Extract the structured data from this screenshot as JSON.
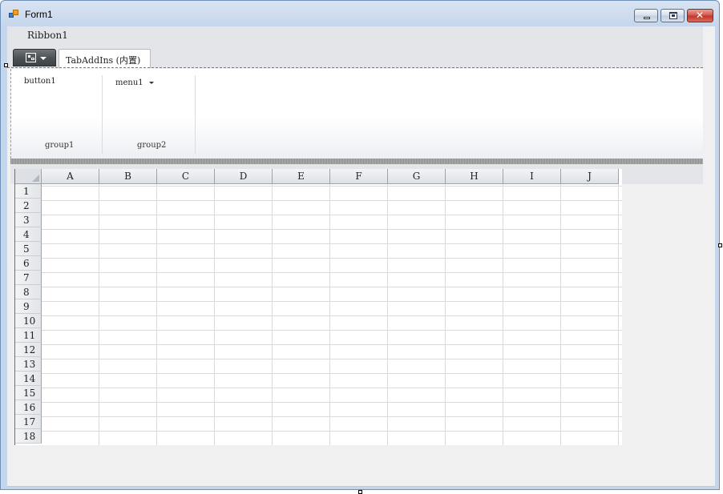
{
  "window": {
    "title": "Form1",
    "minimize_label": "minimize",
    "maximize_label": "maximize",
    "close_label": "close"
  },
  "ribbon": {
    "title": "Ribbon1",
    "tabs": [
      {
        "label": "TabAddIns (内置)",
        "selected": true
      }
    ],
    "groups": [
      {
        "label": "group1",
        "controls": [
          {
            "type": "button",
            "label": "button1"
          }
        ]
      },
      {
        "label": "group2",
        "controls": [
          {
            "type": "menu",
            "label": "menu1"
          }
        ]
      }
    ]
  },
  "sheet": {
    "columns": [
      "A",
      "B",
      "C",
      "D",
      "E",
      "F",
      "G",
      "H",
      "I",
      "J"
    ],
    "rows": [
      "1",
      "2",
      "3",
      "4",
      "5",
      "6",
      "7",
      "8",
      "9",
      "10",
      "11",
      "12",
      "13",
      "14",
      "15",
      "16",
      "17",
      "18"
    ]
  },
  "colors": {
    "window_frame": "#6e8fb8",
    "client_bg": "#f0f0f0",
    "ribbon_bg": "#e3e5e9",
    "app_button": "#4b5054",
    "grid_line": "#dadada",
    "header_bg": "#dde1e6"
  }
}
